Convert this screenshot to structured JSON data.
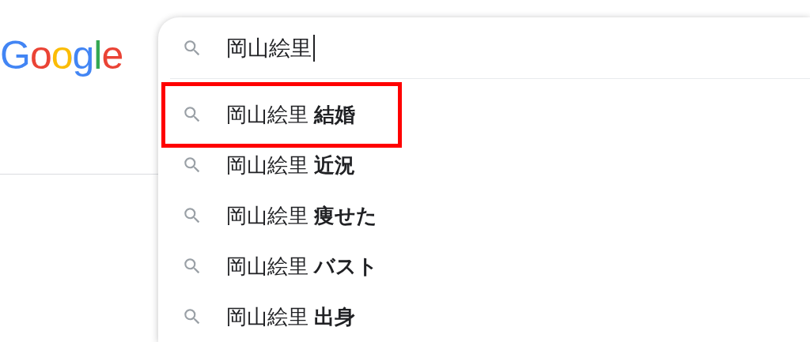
{
  "logo": "Google",
  "search": {
    "value": "岡山絵里"
  },
  "suggestions": [
    {
      "text": "岡山絵里 **結婚**",
      "highlighted": true
    },
    {
      "text": "岡山絵里 **近況**",
      "highlighted": false
    },
    {
      "text": "岡山絵里 **痩せた**",
      "highlighted": false
    },
    {
      "text": "岡山絵里 **バスト**",
      "highlighted": false
    },
    {
      "text": "岡山絵里 **出身**",
      "highlighted": false
    }
  ]
}
